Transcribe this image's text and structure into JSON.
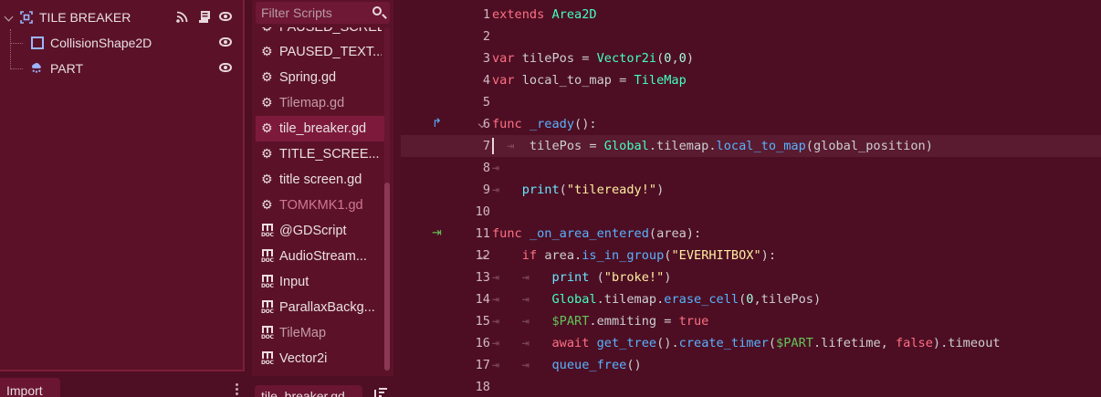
{
  "scene_tree": {
    "root": {
      "label": "TILE BREAKER"
    },
    "children": [
      {
        "label": "CollisionShape2D"
      },
      {
        "label": "PART"
      }
    ]
  },
  "bottom_left_tab": {
    "label": "Import"
  },
  "scripts_panel": {
    "filter_placeholder": "Filter Scripts",
    "items": [
      {
        "label": "PAUSED_SCREEN...",
        "type": "script"
      },
      {
        "label": "PAUSED_TEXT...",
        "type": "script"
      },
      {
        "label": "Spring.gd",
        "type": "script"
      },
      {
        "label": "Tilemap.gd",
        "type": "script"
      },
      {
        "label": "tile_breaker.gd",
        "type": "script",
        "selected": true
      },
      {
        "label": "TITLE_SCREE...",
        "type": "script"
      },
      {
        "label": "title screen.gd",
        "type": "script"
      },
      {
        "label": "TOMKMK1.gd",
        "type": "script"
      },
      {
        "label": "@GDScript",
        "type": "doc"
      },
      {
        "label": "AudioStream...",
        "type": "doc"
      },
      {
        "label": "Input",
        "type": "doc"
      },
      {
        "label": "ParallaxBackg...",
        "type": "doc"
      },
      {
        "label": "TileMap",
        "type": "doc"
      },
      {
        "label": "Vector2i",
        "type": "doc"
      }
    ],
    "current_file_tab": "tile_breaker.gd"
  },
  "editor": {
    "current_line": 7,
    "lines": [
      {
        "n": "1",
        "text": "extends Area2D"
      },
      {
        "n": "2",
        "text": ""
      },
      {
        "n": "3",
        "text": "var tilePos = Vector2i(0,0)"
      },
      {
        "n": "4",
        "text": "var local_to_map = TileMap"
      },
      {
        "n": "5",
        "text": ""
      },
      {
        "n": "6",
        "text": "func _ready():"
      },
      {
        "n": "7",
        "text": "tilePos = Global.tilemap.local_to_map(global_position)"
      },
      {
        "n": "8",
        "text": ""
      },
      {
        "n": "9",
        "text": "print(\"tileready!\")"
      },
      {
        "n": "10",
        "text": ""
      },
      {
        "n": "11",
        "text": "func _on_area_entered(area):"
      },
      {
        "n": "12",
        "text": "if area.is_in_group(\"EVERHITBOX\"):"
      },
      {
        "n": "13",
        "text": "print (\"broke!\")"
      },
      {
        "n": "14",
        "text": "Global.tilemap.erase_cell(0,tilePos)"
      },
      {
        "n": "15",
        "text": "$PART.emmiting = true"
      },
      {
        "n": "16",
        "text": "await get_tree().create_timer($PART.lifetime, false).timeout"
      },
      {
        "n": "17",
        "text": "queue_free()"
      },
      {
        "n": "18",
        "text": ""
      }
    ]
  },
  "colors": {
    "background": "#4e0e23",
    "panel": "#5b1229",
    "selected": "#7d1a3c",
    "keyword": "#ff7085",
    "type": "#42ffc2",
    "function": "#57b3ff",
    "string": "#ffeda1",
    "number": "#a1ffe0",
    "node_path": "#63c259"
  },
  "icons": {
    "root_node": "node2d-area-icon",
    "collision": "collision-shape-icon",
    "particles": "particles-cloud-icon",
    "signal": "signal-icon",
    "script": "script-icon",
    "visibility": "eye-icon",
    "script_item": "gear-icon",
    "doc_item": "doc-book-icon",
    "search": "search-icon"
  }
}
